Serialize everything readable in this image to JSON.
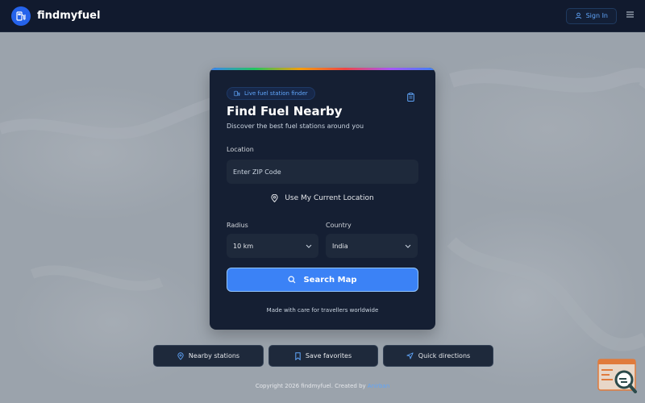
{
  "header": {
    "brand_name": "findmyfuel",
    "signin_label": "Sign In"
  },
  "card": {
    "badge_label": "Live fuel station finder",
    "title": "Find Fuel Nearby",
    "subtitle": "Discover the best fuel stations around you",
    "location_label": "Location",
    "zip_placeholder": "Enter ZIP Code",
    "current_location_label": "Use My Current Location",
    "radius_label": "Radius",
    "radius_value": "10 km",
    "country_label": "Country",
    "country_value": "India",
    "search_label": "Search Map",
    "footnote": "Made with care for travellers worldwide"
  },
  "actions": {
    "nearby_label": "Nearby stations",
    "favorites_label": "Save favorites",
    "directions_label": "Quick directions"
  },
  "footer": {
    "copyright_prefix": "Copyright 2026 findmyfuel. Created by",
    "author": "Anirban"
  },
  "colors": {
    "accent": "#3b82f6",
    "header_bg": "#111a2e",
    "card_bg": "#151f33",
    "input_bg": "#1e293b"
  }
}
